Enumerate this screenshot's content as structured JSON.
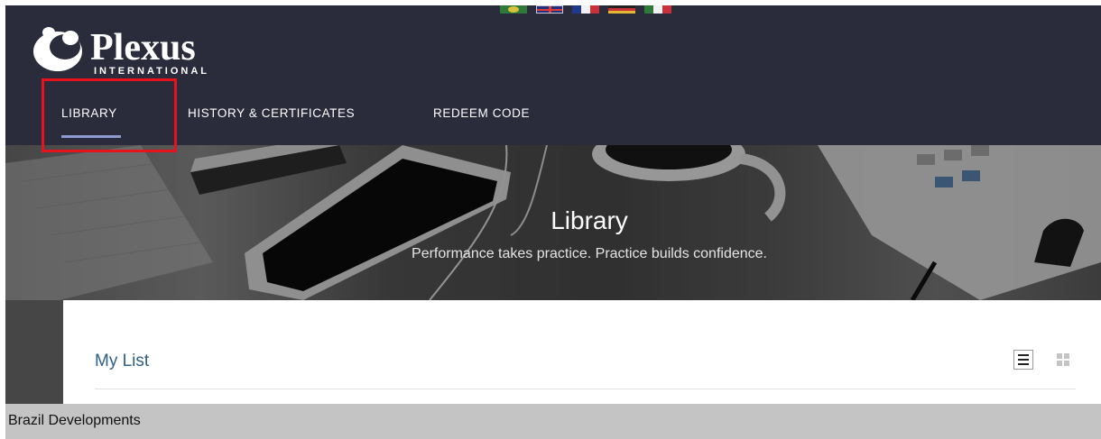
{
  "header": {
    "flags": [
      "brazil-flag-icon",
      "uk-flag-icon",
      "france-flag-icon",
      "germany-flag-icon",
      "italy-flag-icon"
    ],
    "logo": {
      "word": "Plexus",
      "sub": "INTERNATIONAL",
      "icon": "plexus-logo-icon"
    },
    "nav": {
      "library": "LIBRARY",
      "history": "HISTORY & CERTIFICATES",
      "redeem": "REDEEM CODE"
    },
    "active_nav": "library",
    "highlight_color": "#e8121e",
    "background": "#2a2b3b"
  },
  "hero": {
    "title": "Library",
    "subtitle": "Performance takes practice. Practice builds confidence."
  },
  "content": {
    "section_title": "My List",
    "view_list_icon": "list-view-icon",
    "view_grid_icon": "grid-view-icon"
  },
  "bottom_bar": {
    "text": "Brazil Developments"
  },
  "colors": {
    "accent_underline": "#8d9bd0",
    "section_title": "#2e5f86"
  }
}
